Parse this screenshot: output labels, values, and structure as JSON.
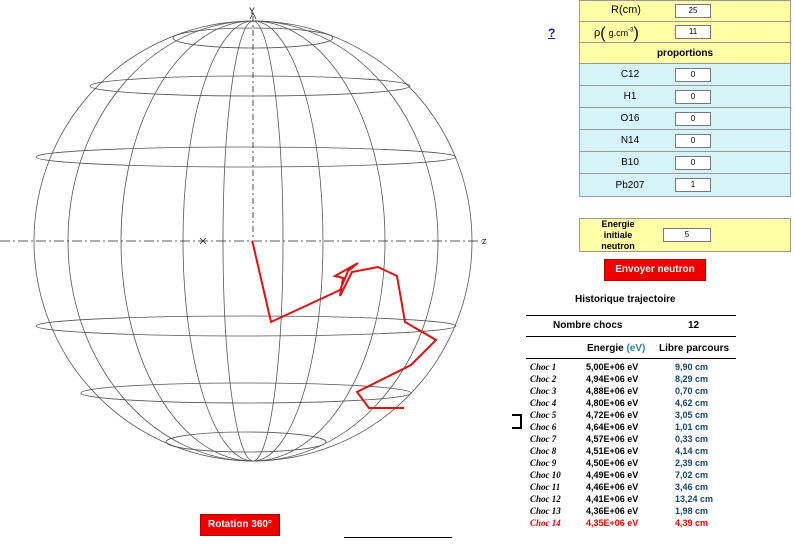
{
  "axes": {
    "y": "Y",
    "z": "Z",
    "x": "X"
  },
  "help_link": "?",
  "params": {
    "radius": {
      "label": "R(cm)",
      "value": "25"
    },
    "density": {
      "label_prefix": "ρ",
      "label_inner": "g.cm",
      "label_exp": "-3",
      "value": "11"
    }
  },
  "proportions": {
    "title": "proportions",
    "items": [
      {
        "label": "C12",
        "value": "0"
      },
      {
        "label": "H1",
        "value": "0"
      },
      {
        "label": "O16",
        "value": "0"
      },
      {
        "label": "N14",
        "value": "0"
      },
      {
        "label": "B10",
        "value": "0"
      },
      {
        "label": "Pb207",
        "value": "1"
      }
    ]
  },
  "energy": {
    "label_line1": "Energie",
    "label_line2": "initiale",
    "label_line3": "neutron",
    "value": "5"
  },
  "send_button": "Envoyer neutron",
  "rotation_button": "Rotation 360°",
  "history": {
    "title": "Historique trajectoire",
    "count_label": "Nombre chocs",
    "count_value": "12",
    "col_energy": "Energie",
    "col_energy_unit": "(eV)",
    "col_path": "Libre parcours",
    "rows": [
      {
        "choc": "Choc 1",
        "energy": "5,00E+06 eV",
        "path": "9,90 cm"
      },
      {
        "choc": "Choc 2",
        "energy": "4,94E+06 eV",
        "path": "8,29 cm"
      },
      {
        "choc": "Choc 3",
        "energy": "4,88E+06 eV",
        "path": "0,70 cm"
      },
      {
        "choc": "Choc 4",
        "energy": "4,80E+06 eV",
        "path": "4,62 cm"
      },
      {
        "choc": "Choc 5",
        "energy": "4,72E+06 eV",
        "path": "3,05 cm"
      },
      {
        "choc": "Choc 6",
        "energy": "4,64E+06 eV",
        "path": "1,01 cm"
      },
      {
        "choc": "Choc 7",
        "energy": "4,57E+06 eV",
        "path": "0,33 cm"
      },
      {
        "choc": "Choc 8",
        "energy": "4,51E+06 eV",
        "path": "4,14 cm"
      },
      {
        "choc": "Choc 9",
        "energy": "4,50E+06 eV",
        "path": "2,39 cm"
      },
      {
        "choc": "Choc 10",
        "energy": "4,49E+06 eV",
        "path": "7,02 cm"
      },
      {
        "choc": "Choc 11",
        "energy": "4,46E+06 eV",
        "path": "3,46 cm"
      },
      {
        "choc": "Choc 12",
        "energy": "4,41E+06 eV",
        "path": "13,24 cm"
      },
      {
        "choc": "Choc 13",
        "energy": "4,36E+06 eV",
        "path": "1,98 cm"
      },
      {
        "choc": "Choc 14",
        "energy": "4,35E+06 eV",
        "path": "4,39 cm"
      }
    ]
  },
  "colors": {
    "trajectory": "#dd1111",
    "accent_red": "#ee0000",
    "cell_yellow": "#ffffa6",
    "cell_cyan": "#d6f4f8"
  }
}
